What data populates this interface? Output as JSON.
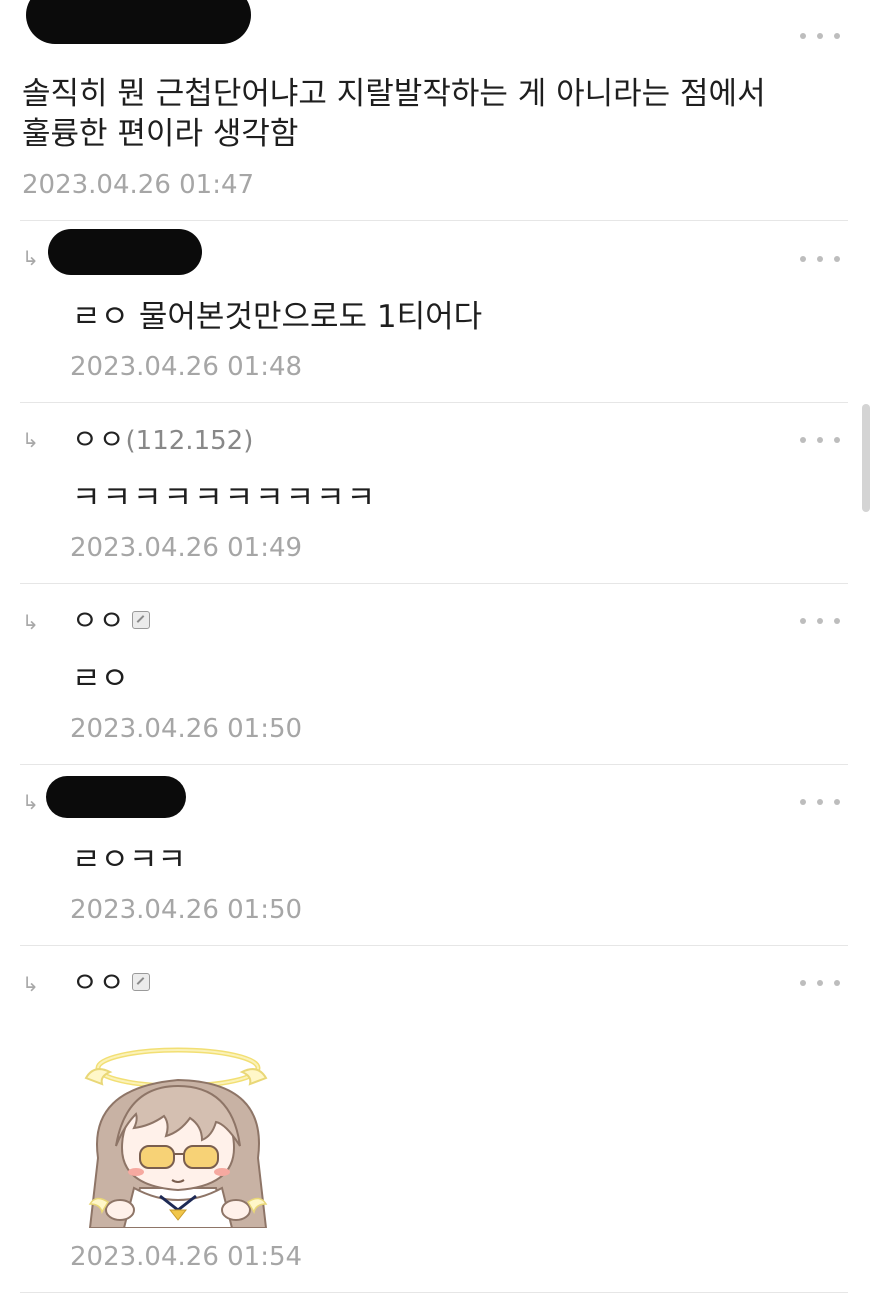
{
  "comments": [
    {
      "author": "",
      "body_line1": "솔직히 뭔 근첩단어냐고 지랄발작하는 게 아니라는 점에서",
      "body_line2": "훌륭한 편이라 생각함",
      "time": "2023.04.26 01:47"
    },
    {
      "author": "",
      "reply_marker": "↳",
      "body": "ㄹㅇ 물어본것만으로도 1티어다",
      "time": "2023.04.26 01:48"
    },
    {
      "reply_marker": "↳",
      "author": "ㅇㅇ",
      "ip": "(112.152)",
      "body": "ㅋㅋㅋㅋㅋㅋㅋㅋㅋㅋ",
      "time": "2023.04.26 01:49"
    },
    {
      "reply_marker": "↳",
      "author": "ㅇㅇ",
      "badge_icon": "fixed-nick-icon",
      "body": "ㄹㅇ",
      "time": "2023.04.26 01:50"
    },
    {
      "reply_marker": "↳",
      "author": "",
      "body": "ㄹㅇㅋㅋ",
      "time": "2023.04.26 01:50"
    },
    {
      "reply_marker": "↳",
      "author": "ㅇㅇ",
      "badge_icon": "fixed-nick-icon",
      "sticker": "halo-chibi-sticker",
      "time": "2023.04.26 01:54"
    }
  ],
  "more_icon": "more-dots-icon",
  "colors": {
    "text": "#1e1e1e",
    "timestamp": "#a6a6a6",
    "divider": "#e6e6e6",
    "redaction": "#0b0b0b"
  }
}
